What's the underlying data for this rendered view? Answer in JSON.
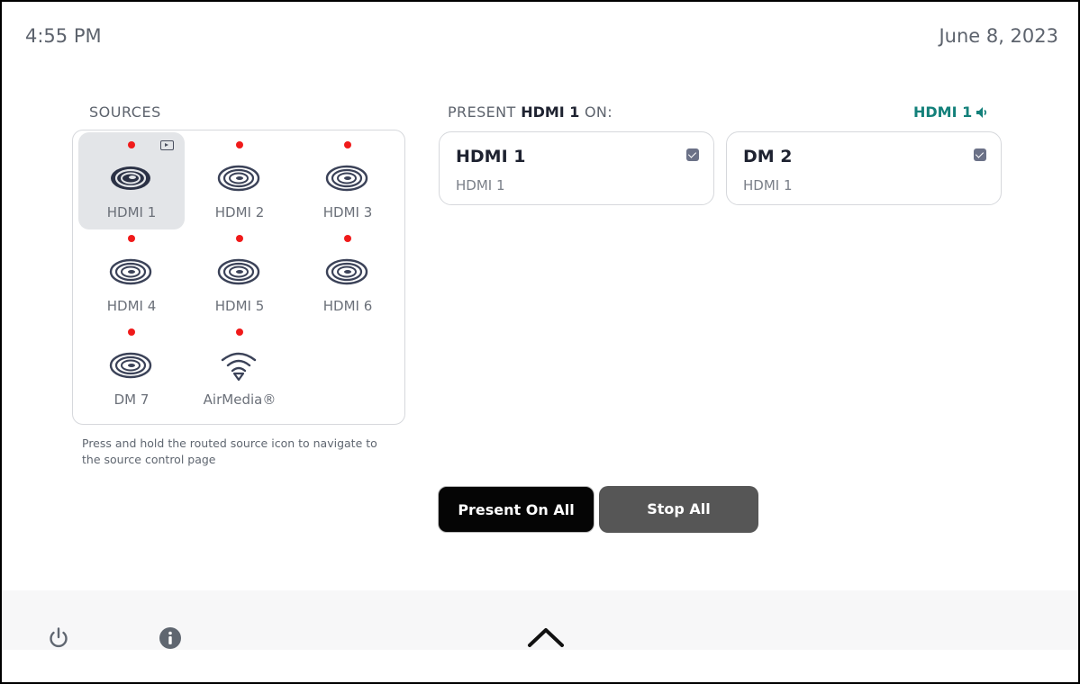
{
  "status_bar": {
    "time": "4:55 PM",
    "date": "June 8, 2023"
  },
  "sources": {
    "title": "SOURCES",
    "items": [
      {
        "label": "HDMI 1",
        "icon": "crestron-swirl-icon",
        "selected": true,
        "routed": true
      },
      {
        "label": "HDMI 2",
        "icon": "crestron-swirl-icon"
      },
      {
        "label": "HDMI 3",
        "icon": "crestron-swirl-icon"
      },
      {
        "label": "HDMI 4",
        "icon": "crestron-swirl-icon"
      },
      {
        "label": "HDMI 5",
        "icon": "crestron-swirl-icon"
      },
      {
        "label": "HDMI 6",
        "icon": "crestron-swirl-icon"
      },
      {
        "label": "DM 7",
        "icon": "crestron-swirl-icon"
      },
      {
        "label": "AirMedia®",
        "icon": "wifi-icon"
      }
    ],
    "hint": "Press and hold the routed source icon to navigate to the source control page",
    "status_color": "#f01a1a"
  },
  "present": {
    "prefix": "PRESENT",
    "source": "HDMI 1",
    "suffix": "ON:",
    "audio_source": "HDMI 1",
    "audio_color": "#13807a"
  },
  "destinations": [
    {
      "name": "HDMI 1",
      "source": "HDMI 1",
      "checked": true
    },
    {
      "name": "DM 2",
      "source": "HDMI 1",
      "checked": true
    }
  ],
  "buttons": {
    "present_all": "Present On All",
    "stop_all": "Stop All"
  },
  "footer": {
    "left_icons": [
      "power-icon",
      "info-icon"
    ],
    "center_icon": "chevron-up-icon"
  }
}
